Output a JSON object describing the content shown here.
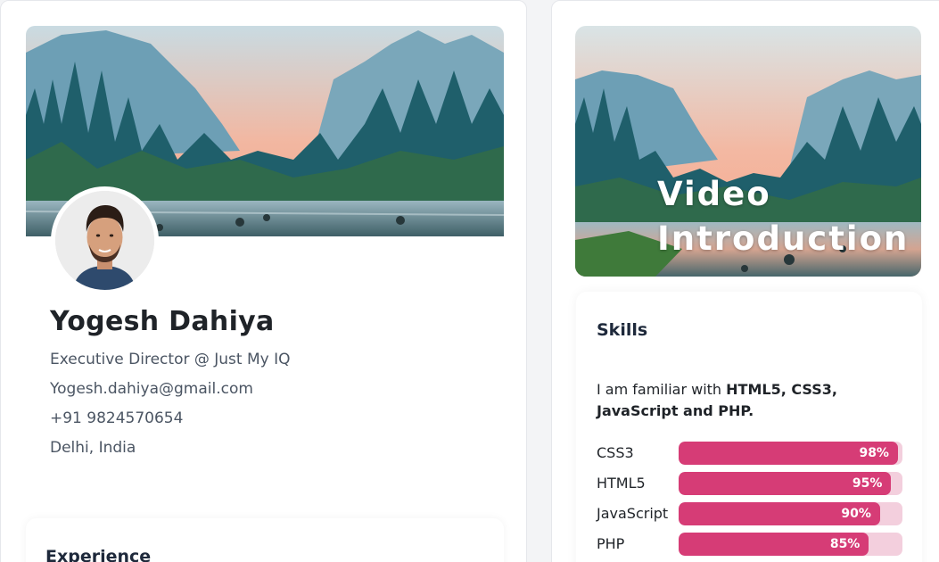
{
  "profile": {
    "name": "Yogesh Dahiya",
    "title": "Executive Director @ Just My IQ",
    "email": "Yogesh.dahiya@gmail.com",
    "phone": "+91 9824570654",
    "location": "Delhi, India"
  },
  "experience": {
    "heading": "Experience"
  },
  "video": {
    "title_line1": "Video",
    "title_line2": "Introduction"
  },
  "skills": {
    "heading": "Skills",
    "desc_prefix": "I am familiar with ",
    "desc_bold": "HTML5, CSS3, JavaScript and PHP.",
    "items": [
      {
        "name": "CSS3",
        "percent": 98,
        "label": "98%"
      },
      {
        "name": "HTML5",
        "percent": 95,
        "label": "95%"
      },
      {
        "name": "JavaScript",
        "percent": 90,
        "label": "90%"
      },
      {
        "name": "PHP",
        "percent": 85,
        "label": "85%"
      }
    ]
  },
  "colors": {
    "bar_fill": "#d63c76",
    "bar_track": "#f3cfdd",
    "heading": "#1e293b"
  }
}
